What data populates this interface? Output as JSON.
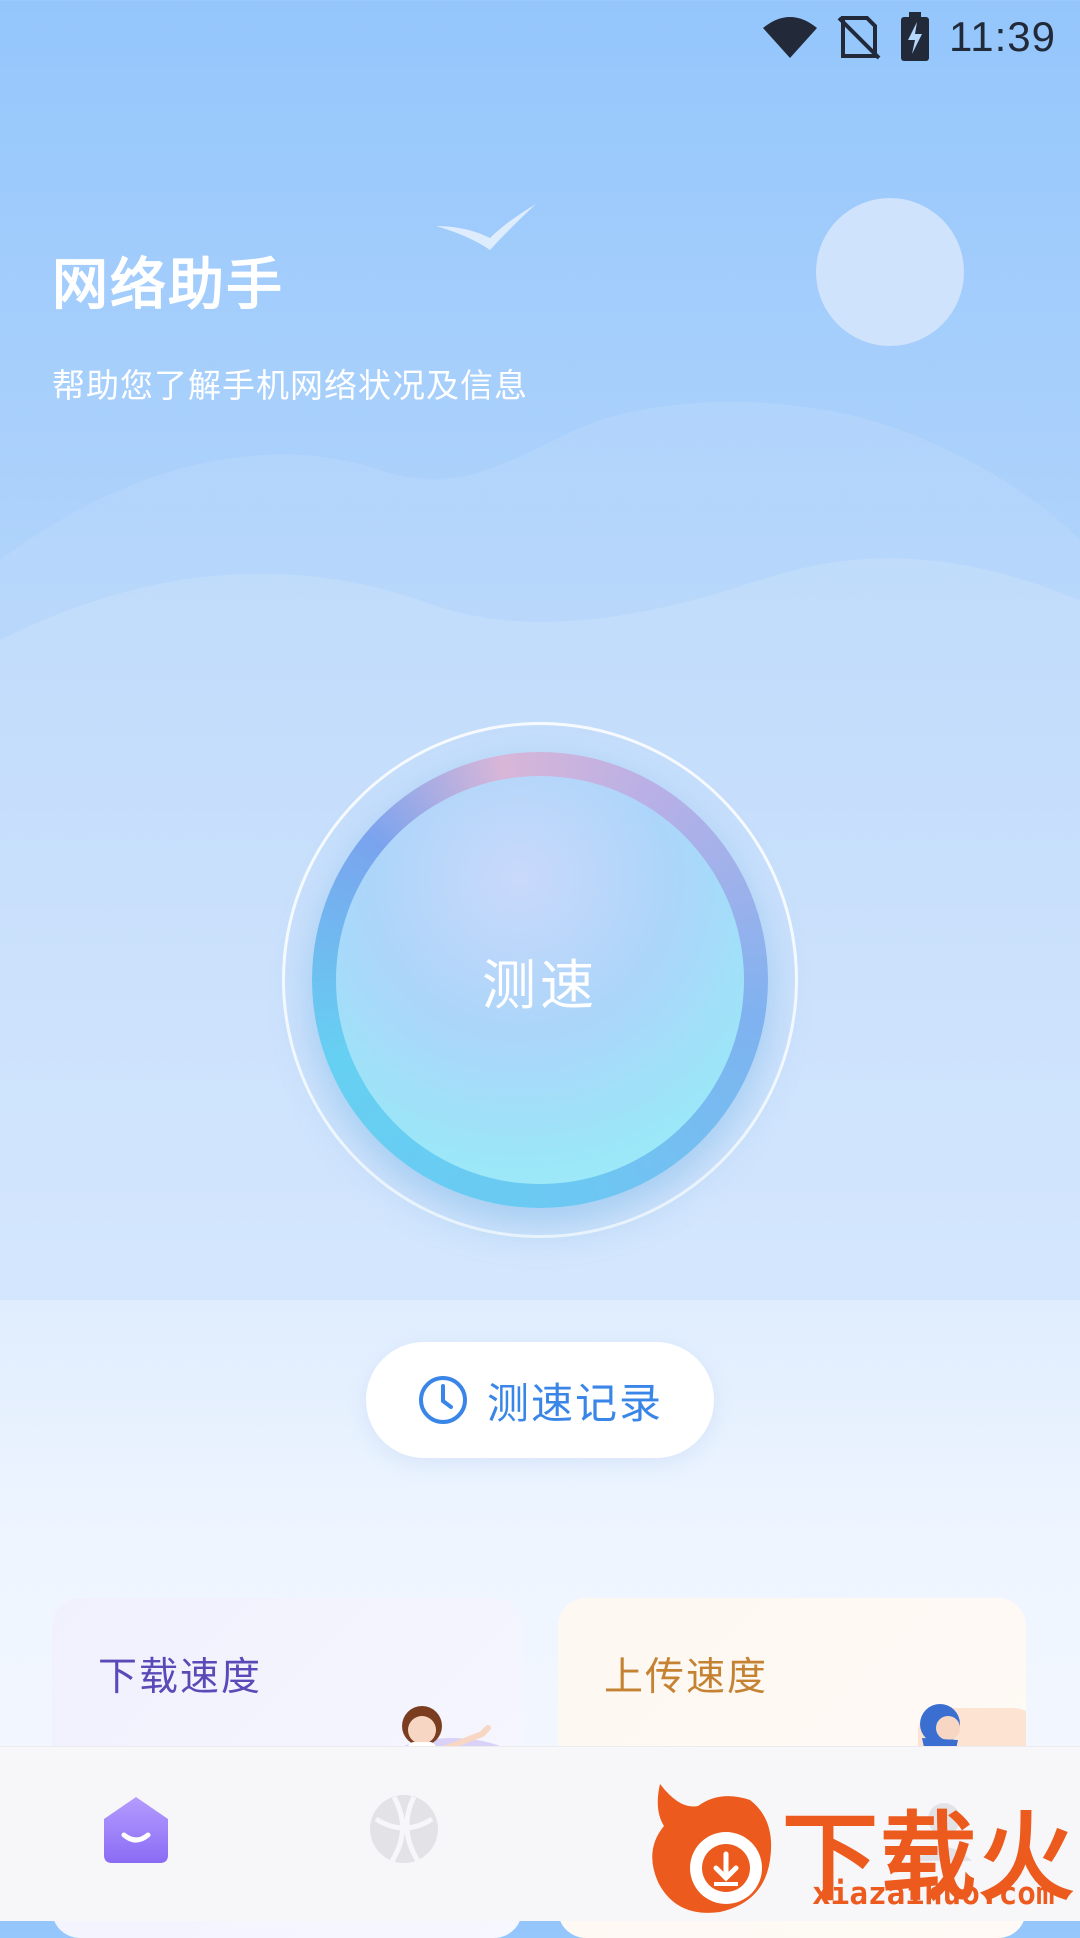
{
  "status_bar": {
    "time": "11:39"
  },
  "header": {
    "title": "网络助手",
    "subtitle": "帮助您了解手机网络状况及信息"
  },
  "speed_test": {
    "label": "测速"
  },
  "history_button": {
    "label": "测速记录",
    "icon": "clock-icon"
  },
  "cards": {
    "download": {
      "title": "下载速度"
    },
    "upload": {
      "title": "上传速度"
    }
  },
  "tab_bar": {
    "tabs": [
      {
        "icon": "home-icon",
        "active": true
      },
      {
        "icon": "globe-icon",
        "active": false
      },
      {
        "icon": "profile-icon",
        "active": false
      }
    ]
  },
  "watermark": {
    "brand": "下载火",
    "site": "xiazaihuo.com"
  },
  "colors": {
    "accent": "#3a86e8",
    "download_title": "#5a4ab8",
    "upload_title": "#c48232",
    "watermark": "#ec5a1e"
  }
}
